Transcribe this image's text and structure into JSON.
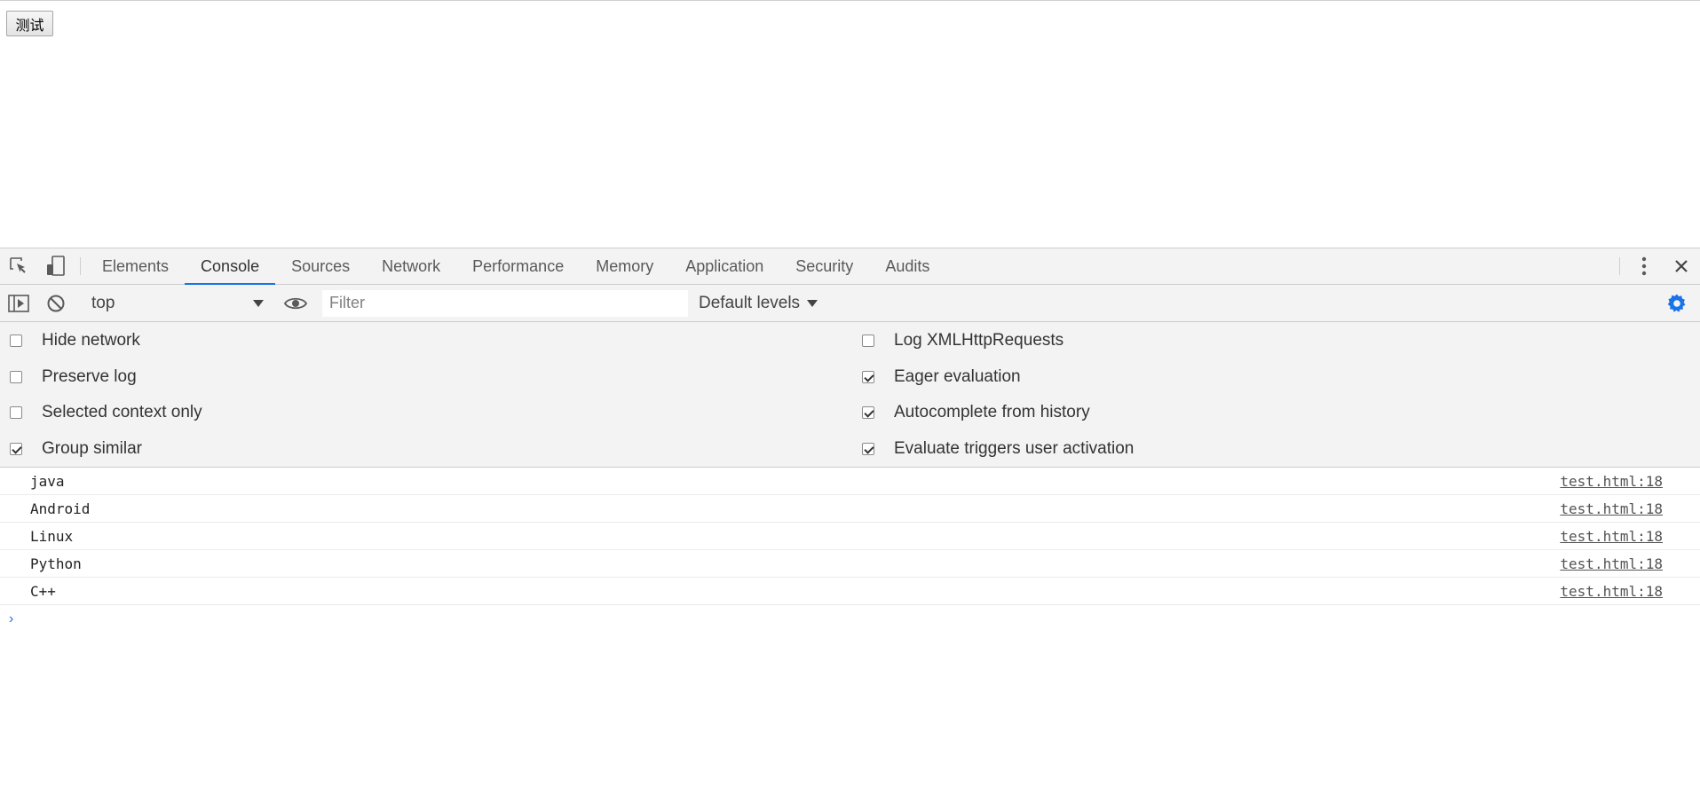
{
  "page": {
    "button_label": "测试"
  },
  "devtools": {
    "tabs": [
      {
        "label": "Elements"
      },
      {
        "label": "Console"
      },
      {
        "label": "Sources"
      },
      {
        "label": "Network"
      },
      {
        "label": "Performance"
      },
      {
        "label": "Memory"
      },
      {
        "label": "Application"
      },
      {
        "label": "Security"
      },
      {
        "label": "Audits"
      }
    ],
    "active_tab": "Console",
    "toolbar": {
      "context": "top",
      "filter_placeholder": "Filter",
      "levels": "Default levels"
    },
    "settings": {
      "left": [
        {
          "label": "Hide network",
          "checked": false
        },
        {
          "label": "Preserve log",
          "checked": false
        },
        {
          "label": "Selected context only",
          "checked": false
        },
        {
          "label": "Group similar",
          "checked": true
        }
      ],
      "right": [
        {
          "label": "Log XMLHttpRequests",
          "checked": false
        },
        {
          "label": "Eager evaluation",
          "checked": true
        },
        {
          "label": "Autocomplete from history",
          "checked": true
        },
        {
          "label": "Evaluate triggers user activation",
          "checked": true
        }
      ]
    },
    "messages": [
      {
        "text": "java",
        "source": "test.html:18"
      },
      {
        "text": "Android",
        "source": "test.html:18"
      },
      {
        "text": "Linux",
        "source": "test.html:18"
      },
      {
        "text": "Python",
        "source": "test.html:18"
      },
      {
        "text": "C++",
        "source": "test.html:18"
      }
    ],
    "prompt_symbol": "›"
  },
  "colors": {
    "accent": "#1a73e8",
    "panel": "#f3f3f3"
  }
}
